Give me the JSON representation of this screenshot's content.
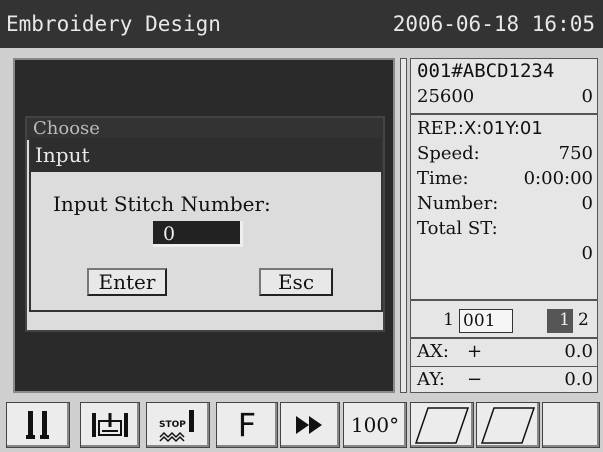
{
  "window": {
    "title": "Embroidery Design",
    "datetime": "2006-06-18 16:05"
  },
  "info": {
    "design_id": "001#ABCD1234",
    "stitch_count": "25600",
    "stitch_right": "0",
    "rep_label": "REP.",
    "rep_value": ":X:01Y:01",
    "speed_label": "Speed:",
    "speed_value": "750",
    "time_label": "Time:",
    "time_value": "0:00:00",
    "number_label": "Number:",
    "number_value": "0",
    "total_label": "Total ST:",
    "total_value": "0",
    "counter_left": "1",
    "counter_code": "001",
    "counter_sel": "1",
    "counter_right": "2",
    "ax_label": "AX:",
    "ax_sign": "+",
    "ax_value": "0.0",
    "ay_label": "AY:",
    "ay_sign": "−",
    "ay_value": "0.0"
  },
  "dialog_back": {
    "title": "Choose"
  },
  "dialog": {
    "title": "Input",
    "prompt": "Input Stitch Number:",
    "value": "0",
    "enter_label": "Enter",
    "esc_label": "Esc"
  },
  "toolbar": {
    "f_label": "F",
    "angle_label": "100°",
    "icons": [
      "needle-bar-icon",
      "frame-needle-icon",
      "stop-stitch-icon",
      "f-key-icon",
      "fast-forward-icon",
      "angle-button",
      "parallelogram-icon",
      "parallelogram-icon"
    ]
  }
}
